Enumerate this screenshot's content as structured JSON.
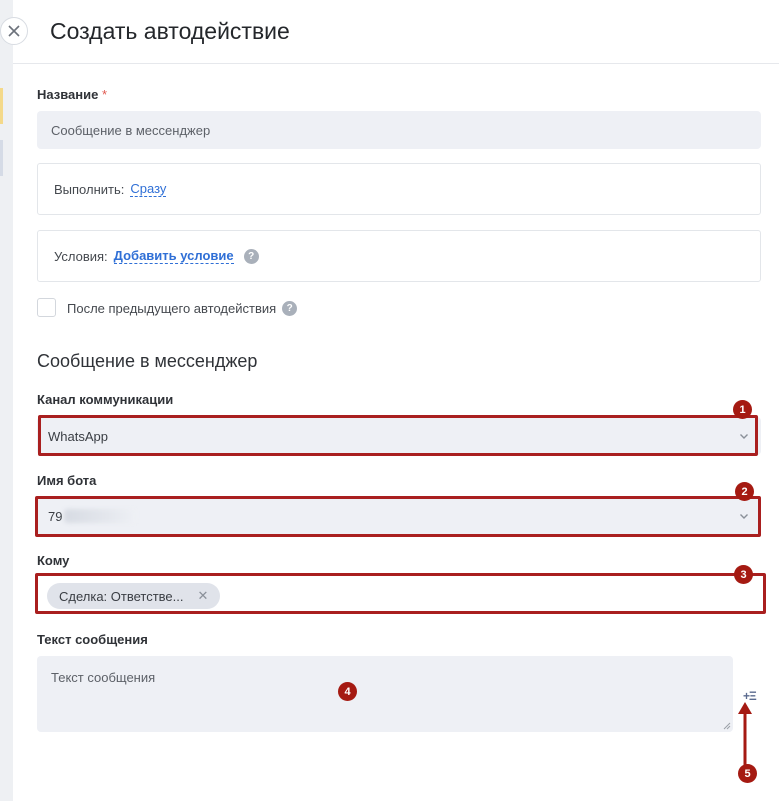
{
  "header": {
    "title": "Создать автодействие"
  },
  "form": {
    "name_label": "Название",
    "name_required": "*",
    "name_value": "Сообщение в мессенджер",
    "execute_label": "Выполнить:",
    "execute_value": "Сразу",
    "conditions_label": "Условия:",
    "conditions_link": "Добавить условие",
    "after_previous_label": "После предыдущего автодействия",
    "help_glyph": "?"
  },
  "section": {
    "title": "Сообщение в мессенджер",
    "channel_label": "Канал коммуникации",
    "channel_value": "WhatsApp",
    "bot_label": "Имя бота",
    "bot_value_prefix": "79",
    "to_label": "Кому",
    "to_chip": "Сделка: Ответстве...",
    "message_label": "Текст сообщения",
    "message_placeholder": "Текст сообщения",
    "insert_variable": "+Ξ"
  },
  "annotations": {
    "badges": [
      "1",
      "2",
      "3",
      "4",
      "5"
    ],
    "color": "#a51a12"
  }
}
